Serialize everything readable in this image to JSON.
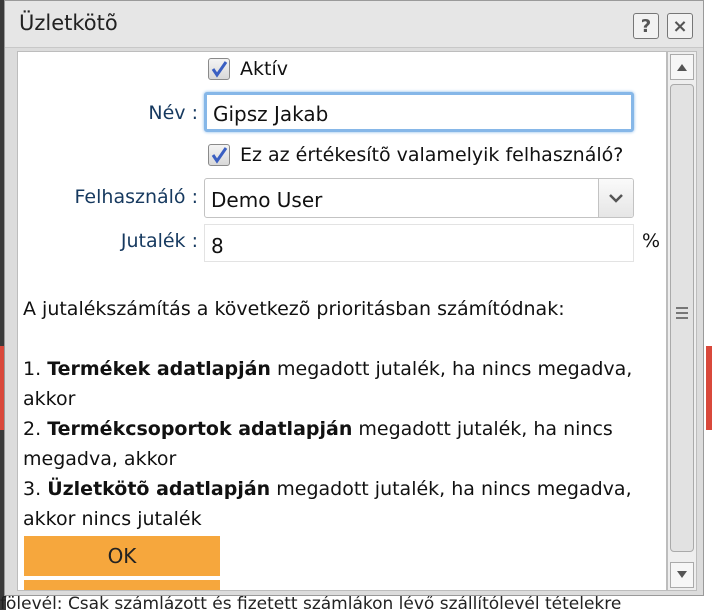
{
  "background": {
    "footer_text": "fölevél: Csak számlázott és fizetett számlákon lévő szállítólevél tételekre"
  },
  "dialog": {
    "title": "Üzletkötõ",
    "help_label": "?",
    "close_label": "×",
    "aktiv": {
      "label": "Aktív",
      "checked": true
    },
    "nev": {
      "label": "Név :",
      "value": "Gipsz Jakab"
    },
    "ertekesito": {
      "label": "Ez az értékesítõ valamelyik felhasználó?",
      "checked": true
    },
    "felhasznalo": {
      "label": "Felhasználó :",
      "value": "Demo User"
    },
    "jutalek": {
      "label": "Jutalék :",
      "value": "8",
      "unit": "%"
    },
    "info": {
      "intro": "A jutalékszámítás a következõ prioritásban számítódnak:",
      "items": [
        {
          "num": "1.",
          "bold": "Termékek adatlapján",
          "rest": " megadott jutalék, ha nincs megadva, akkor"
        },
        {
          "num": "2.",
          "bold": "Termékcsoportok adatlapján",
          "rest": " megadott jutalék, ha nincs megadva, akkor"
        },
        {
          "num": "3.",
          "bold": "Üzletkötõ adatlapján",
          "rest": " megadott jutalék, ha nincs megadva, akkor nincs jutalék"
        }
      ]
    },
    "ok_label": "OK"
  },
  "colors": {
    "accent": "#f6a73d",
    "label": "#16395f",
    "focus": "#86b7e8",
    "background_red": "#d9483b"
  }
}
